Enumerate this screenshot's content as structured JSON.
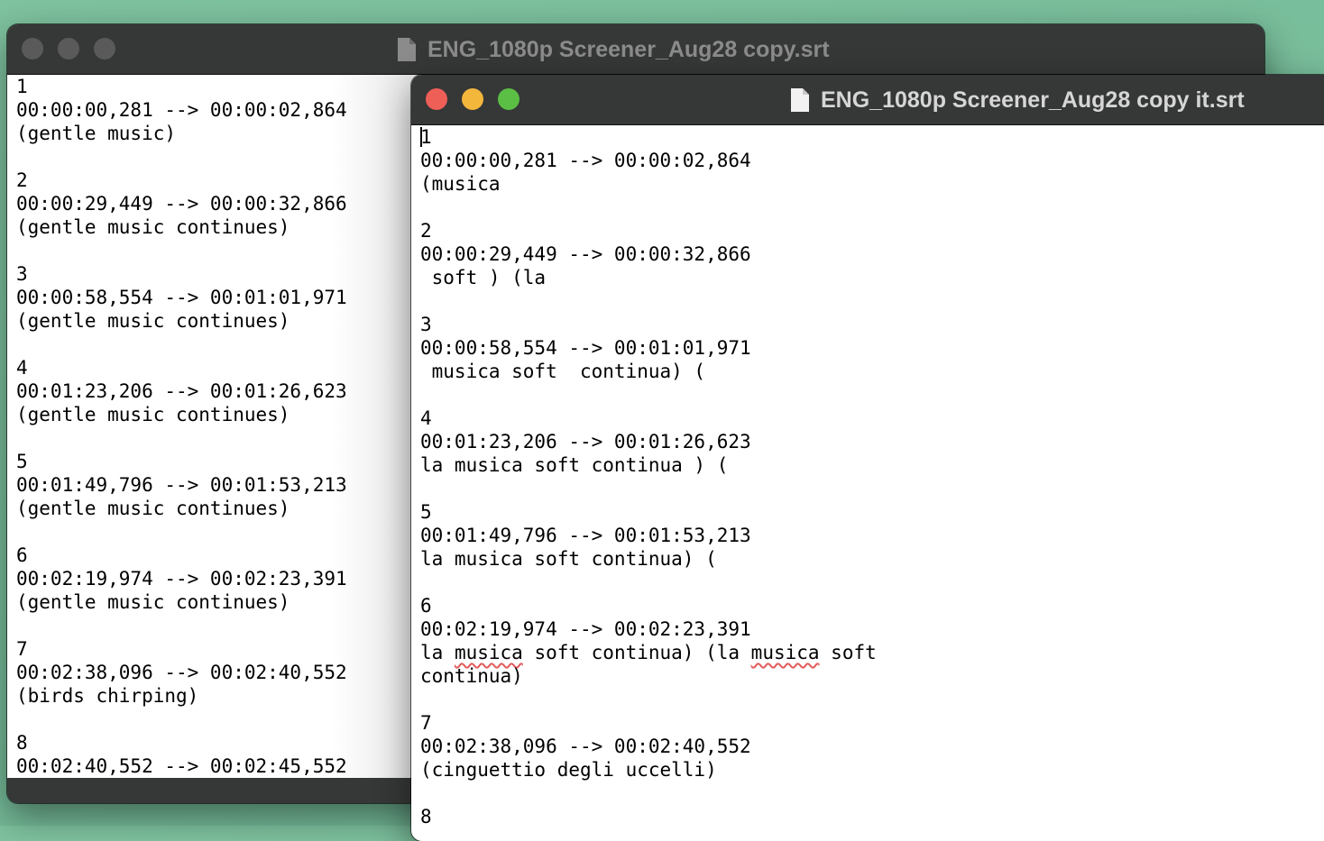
{
  "back_window": {
    "title": "ENG_1080p Screener_Aug28 copy.srt",
    "icon": "document-icon",
    "lights": [
      "#5a5a5a",
      "#5a5a5a",
      "#5a5a5a"
    ],
    "lines": [
      "1",
      "00:00:00,281 --> 00:00:02,864",
      "(gentle music)",
      "",
      "2",
      "00:00:29,449 --> 00:00:32,866",
      "(gentle music continues)",
      "",
      "3",
      "00:00:58,554 --> 00:01:01,971",
      "(gentle music continues)",
      "",
      "4",
      "00:01:23,206 --> 00:01:26,623",
      "(gentle music continues)",
      "",
      "5",
      "00:01:49,796 --> 00:01:53,213",
      "(gentle music continues)",
      "",
      "6",
      "00:02:19,974 --> 00:02:23,391",
      "(gentle music continues)",
      "",
      "7",
      "00:02:38,096 --> 00:02:40,552",
      "(birds chirping)",
      "",
      "8",
      "00:02:40,552 --> 00:02:45,552"
    ]
  },
  "front_window": {
    "title": "ENG_1080p Screener_Aug28 copy it.srt",
    "icon": "document-icon",
    "lights": [
      "#ee5f57",
      "#f3b73c",
      "#5bbf45"
    ],
    "cursor_line": 0,
    "lines": [
      "1",
      "00:00:00,281 --> 00:00:02,864",
      "(musica",
      "",
      "2",
      "00:00:29,449 --> 00:00:32,866",
      " soft ) (la",
      "",
      "3",
      "00:00:58,554 --> 00:01:01,971",
      " musica soft  continua) (",
      "",
      "4",
      "00:01:23,206 --> 00:01:26,623",
      "la musica soft continua ) (",
      "",
      "5",
      "00:01:49,796 --> 00:01:53,213",
      "la musica soft continua) (",
      "",
      "6",
      "00:02:19,974 --> 00:02:23,391",
      "la musica soft continua) (la musica soft",
      "continua)",
      "",
      "7",
      "00:02:38,096 --> 00:02:40,552",
      "(cinguettio degli uccelli)",
      "",
      "8"
    ],
    "misspelled": {
      "line": 22,
      "word": "musica"
    }
  }
}
